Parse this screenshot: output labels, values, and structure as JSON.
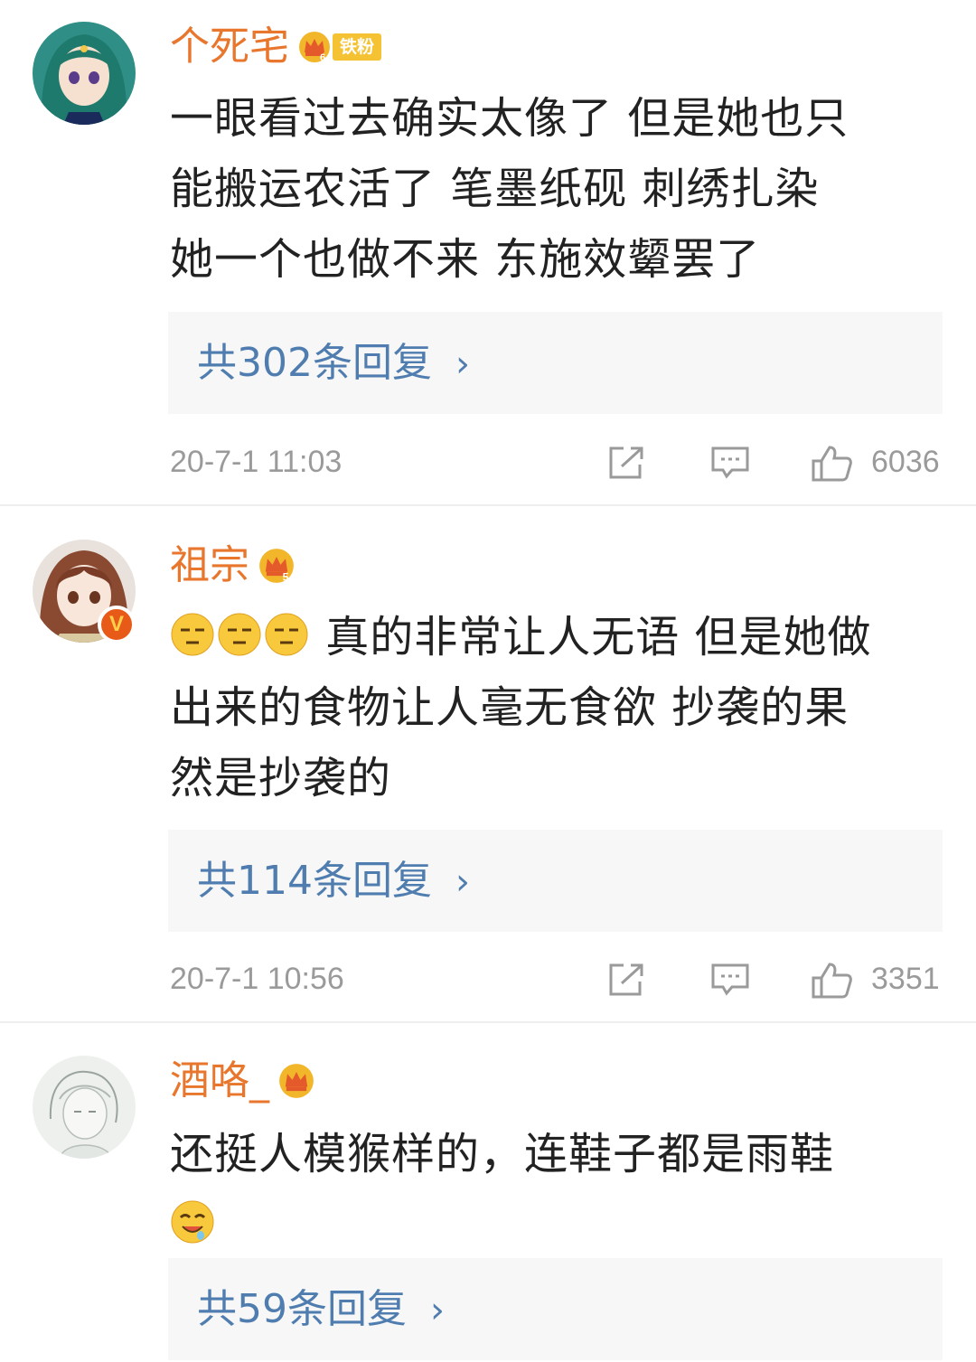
{
  "comments": [
    {
      "username": "个死宅",
      "fan_badge": "铁粉",
      "crown_level": "6",
      "verified": false,
      "text_lines": [
        "一眼看过去确实太像了  但是她也只",
        "能搬运农活了  笔墨纸砚 刺绣扎染",
        "她一个也做不来 东施效颦罢了"
      ],
      "reply_label": "共302条回复",
      "timestamp": "20-7-1 11:03",
      "likes": "6036",
      "avatar_icon": "anime-girl-green-hair-avatar"
    },
    {
      "username": "祖宗",
      "crown_level": "5",
      "verified": true,
      "verified_label": "V",
      "emojis": [
        "speechless-emoji",
        "speechless-emoji",
        "speechless-emoji"
      ],
      "text_lines": [
        " 真的非常让人无语 但是她做",
        "出来的食物让人毫无食欲 抄袭的果",
        "然是抄袭的"
      ],
      "reply_label": "共114条回复",
      "timestamp": "20-7-1 10:56",
      "likes": "3351",
      "avatar_icon": "anime-girl-brown-hair-avatar"
    },
    {
      "username": "酒咯_",
      "crown_level": "",
      "verified": false,
      "text_lines": [
        "还挺人模猴样的，连鞋子都是雨鞋"
      ],
      "trailing_emoji": "drooling-emoji",
      "reply_label": "共59条回复",
      "avatar_icon": "sketch-boy-avatar"
    }
  ],
  "chevron": "›",
  "icons": [
    "share-icon",
    "comment-icon",
    "like-icon",
    "crown-icon"
  ],
  "colors": {
    "username": "#e8762d",
    "reply_link": "#507daf",
    "meta_gray": "#9a9a9a",
    "reply_bg": "#f7f7f7",
    "verified_badge": "#e85a17"
  }
}
